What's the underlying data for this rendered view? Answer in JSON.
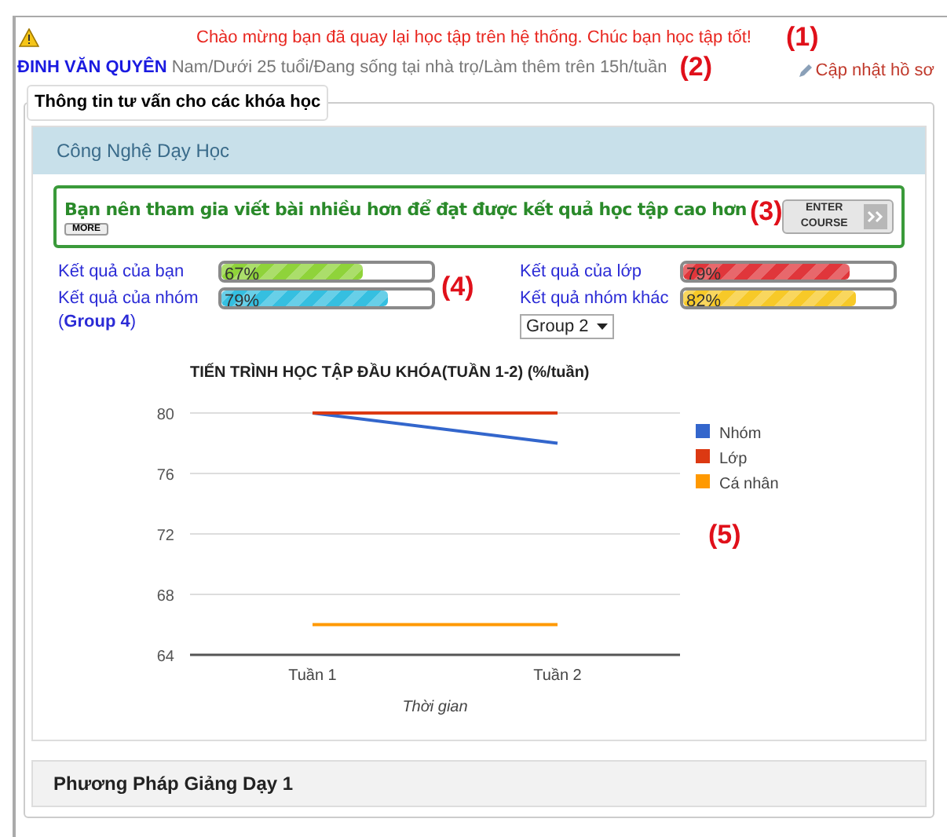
{
  "notice": {
    "message": "Chào mừng bạn đã quay lại học tập trên hệ thống. Chúc bạn học tập tốt!"
  },
  "user": {
    "name": "ĐINH VĂN QUYÊN",
    "profile": "Nam/Dưới 25 tuổi/Đang sống tại nhà trọ/Làm thêm trên 15h/tuần",
    "update_link": "Cập nhật hồ sơ"
  },
  "annotations": [
    "(1)",
    "(2)",
    "(3)",
    "(4)",
    "(5)"
  ],
  "section": {
    "legend": "Thông tin tư vấn cho các khóa học"
  },
  "course": {
    "title": "Công Nghệ Dạy Học",
    "recommendation": "Bạn nên tham gia viết bài nhiều hơn để đạt được kết quả học tập cao hơn",
    "more_button": "MORE",
    "enter_button": "ENTER COURSE",
    "results": [
      {
        "label": "Kết quả của bạn",
        "percent": "67%",
        "level": 0.67,
        "color": "#8fd33a"
      },
      {
        "label": "Kết quả của lớp",
        "percent": "79%",
        "level": 0.79,
        "color": "#e0363b"
      },
      {
        "label": "Kết quả của nhóm (**Group 4**)",
        "percent": "79%",
        "level": 0.79,
        "color": "#35bfe0"
      },
      {
        "label": "Kết quả nhóm khác",
        "percent": "82%",
        "level": 0.82,
        "color": "#f7c928"
      }
    ],
    "group_select": {
      "value": "Group 2"
    },
    "chart_data": {
      "type": "line",
      "title": "TIẾN TRÌNH HỌC TẬP ĐẦU KHÓA(TUẦN 1-2) (%/tuần)",
      "xlabel": "Thời gian",
      "categories": [
        "Tuần 1",
        "Tuần 2"
      ],
      "ylim": [
        64,
        80
      ],
      "yticks": [
        64,
        68,
        72,
        76,
        80
      ],
      "grid": true,
      "legend": "right",
      "series": [
        {
          "name": "Nhóm",
          "color": "#3366cc",
          "values": [
            80,
            78
          ]
        },
        {
          "name": "Lớp",
          "color": "#dc3912",
          "values": [
            80,
            80
          ]
        },
        {
          "name": "Cá nhân",
          "color": "#ff9900",
          "values": [
            66,
            66
          ]
        }
      ]
    }
  },
  "next_course": {
    "title": "Phương Pháp Giảng Dạy 1"
  }
}
